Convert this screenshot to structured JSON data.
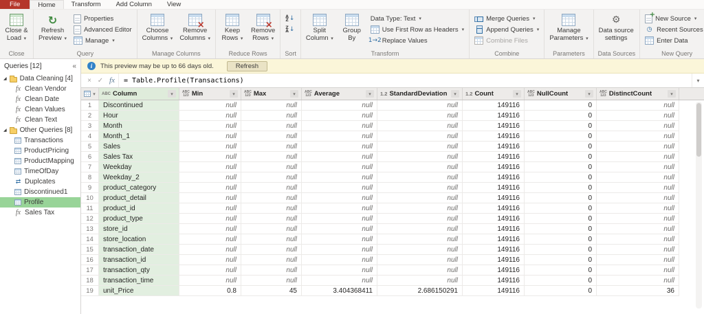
{
  "tabbar": {
    "file_label": "File",
    "tabs": [
      {
        "label": "Home",
        "active": true
      },
      {
        "label": "Transform",
        "active": false
      },
      {
        "label": "Add Column",
        "active": false
      },
      {
        "label": "View",
        "active": false
      }
    ]
  },
  "ribbon": {
    "groups": [
      {
        "label": "Close",
        "big": [
          {
            "line1": "Close &",
            "line2": "Load",
            "dropdown": true,
            "icon": "close-load"
          }
        ]
      },
      {
        "label": "Query",
        "big": [
          {
            "line1": "Refresh",
            "line2": "Preview",
            "dropdown": true,
            "icon": "refresh"
          }
        ],
        "small": [
          {
            "label": "Properties",
            "icon": "properties"
          },
          {
            "label": "Advanced Editor",
            "icon": "advanced-editor"
          },
          {
            "label": "Manage",
            "dropdown": true,
            "icon": "manage"
          }
        ]
      },
      {
        "label": "Manage Columns",
        "big": [
          {
            "line1": "Choose",
            "line2": "Columns",
            "dropdown": true,
            "icon": "choose-columns"
          },
          {
            "line1": "Remove",
            "line2": "Columns",
            "dropdown": true,
            "icon": "remove-columns"
          }
        ]
      },
      {
        "label": "Reduce Rows",
        "big": [
          {
            "line1": "Keep",
            "line2": "Rows",
            "dropdown": true,
            "icon": "keep-rows"
          },
          {
            "line1": "Remove",
            "line2": "Rows",
            "dropdown": true,
            "icon": "remove-rows"
          }
        ]
      },
      {
        "label": "Sort",
        "small_icons": [
          {
            "icon": "sort-az"
          },
          {
            "icon": "sort-za"
          }
        ]
      },
      {
        "label": "Transform",
        "big": [
          {
            "line1": "Split",
            "line2": "Column",
            "dropdown": true,
            "icon": "split-column"
          },
          {
            "line1": "Group",
            "line2": "By",
            "dropdown": false,
            "icon": "group-by"
          }
        ],
        "small": [
          {
            "label": "Data Type: Text",
            "dropdown": true
          },
          {
            "label": "Use First Row as Headers",
            "dropdown": true,
            "icon": "first-row-headers"
          },
          {
            "label": "Replace Values",
            "icon": "replace-values"
          }
        ]
      },
      {
        "label": "Combine",
        "small": [
          {
            "label": "Merge Queries",
            "dropdown": true,
            "icon": "merge-queries"
          },
          {
            "label": "Append Queries",
            "dropdown": true,
            "icon": "append-queries"
          },
          {
            "label": "Combine Files",
            "icon": "combine-files",
            "disabled": true
          }
        ]
      },
      {
        "label": "Parameters",
        "big": [
          {
            "line1": "Manage",
            "line2": "Parameters",
            "dropdown": true,
            "icon": "manage-parameters"
          }
        ]
      },
      {
        "label": "Data Sources",
        "big": [
          {
            "line1": "Data source",
            "line2": "settings",
            "dropdown": false,
            "icon": "data-source-settings"
          }
        ]
      },
      {
        "label": "New Query",
        "small": [
          {
            "label": "New Source",
            "dropdown": true,
            "icon": "new-source"
          },
          {
            "label": "Recent Sources",
            "dropdown": true,
            "icon": "recent-sources"
          },
          {
            "label": "Enter Data",
            "icon": "enter-data"
          }
        ]
      }
    ]
  },
  "notification": {
    "text": "This preview may be up to 66 days old.",
    "button_label": "Refresh"
  },
  "formula_bar": {
    "formula": "= Table.Profile(Transactions)"
  },
  "sidebar": {
    "header": "Queries [12]",
    "collapse_icon": "«",
    "tree": [
      {
        "label": "Data Cleaning [4]",
        "type": "folder",
        "expanded": true,
        "children": [
          {
            "label": "Clean Vendor",
            "type": "fx"
          },
          {
            "label": "Clean Date",
            "type": "fx"
          },
          {
            "label": "Clean Values",
            "type": "fx"
          },
          {
            "label": "Clean Text",
            "type": "fx"
          }
        ]
      },
      {
        "label": "Other Queries [8]",
        "type": "folder",
        "expanded": true,
        "children": [
          {
            "label": "Transactions",
            "type": "table"
          },
          {
            "label": "ProductPricing",
            "type": "table"
          },
          {
            "label": "ProductMapping",
            "type": "table"
          },
          {
            "label": "TimeOfDay",
            "type": "table"
          },
          {
            "label": "Duplcates",
            "type": "merge"
          },
          {
            "label": "Discontinued1",
            "type": "table"
          },
          {
            "label": "Profile",
            "type": "table",
            "selected": true
          },
          {
            "label": "Sales Tax",
            "type": "fx"
          }
        ]
      }
    ]
  },
  "grid": {
    "columns": [
      {
        "name": "Column",
        "type_icon": "ABC"
      },
      {
        "name": "Min",
        "type_icon": "ABC123"
      },
      {
        "name": "Max",
        "type_icon": "ABC123"
      },
      {
        "name": "Average",
        "type_icon": "ABC123"
      },
      {
        "name": "StandardDeviation",
        "type_icon": "1.2"
      },
      {
        "name": "Count",
        "type_icon": "1.2"
      },
      {
        "name": "NullCount",
        "type_icon": "ABC123"
      },
      {
        "name": "DistinctCount",
        "type_icon": "ABC123"
      }
    ],
    "rows": [
      {
        "n": 1,
        "cells": [
          "Discontinued",
          "null",
          "null",
          "null",
          "null",
          "149116",
          "0",
          "null"
        ]
      },
      {
        "n": 2,
        "cells": [
          "Hour",
          "null",
          "null",
          "null",
          "null",
          "149116",
          "0",
          "null"
        ]
      },
      {
        "n": 3,
        "cells": [
          "Month",
          "null",
          "null",
          "null",
          "null",
          "149116",
          "0",
          "null"
        ]
      },
      {
        "n": 4,
        "cells": [
          "Month_1",
          "null",
          "null",
          "null",
          "null",
          "149116",
          "0",
          "null"
        ]
      },
      {
        "n": 5,
        "cells": [
          "Sales",
          "null",
          "null",
          "null",
          "null",
          "149116",
          "0",
          "null"
        ]
      },
      {
        "n": 6,
        "cells": [
          "Sales Tax",
          "null",
          "null",
          "null",
          "null",
          "149116",
          "0",
          "null"
        ]
      },
      {
        "n": 7,
        "cells": [
          "Weekday",
          "null",
          "null",
          "null",
          "null",
          "149116",
          "0",
          "null"
        ]
      },
      {
        "n": 8,
        "cells": [
          "Weekday_2",
          "null",
          "null",
          "null",
          "null",
          "149116",
          "0",
          "null"
        ]
      },
      {
        "n": 9,
        "cells": [
          "product_category",
          "null",
          "null",
          "null",
          "null",
          "149116",
          "0",
          "null"
        ]
      },
      {
        "n": 10,
        "cells": [
          "product_detail",
          "null",
          "null",
          "null",
          "null",
          "149116",
          "0",
          "null"
        ]
      },
      {
        "n": 11,
        "cells": [
          "product_id",
          "null",
          "null",
          "null",
          "null",
          "149116",
          "0",
          "null"
        ]
      },
      {
        "n": 12,
        "cells": [
          "product_type",
          "null",
          "null",
          "null",
          "null",
          "149116",
          "0",
          "null"
        ]
      },
      {
        "n": 13,
        "cells": [
          "store_id",
          "null",
          "null",
          "null",
          "null",
          "149116",
          "0",
          "null"
        ]
      },
      {
        "n": 14,
        "cells": [
          "store_location",
          "null",
          "null",
          "null",
          "null",
          "149116",
          "0",
          "null"
        ]
      },
      {
        "n": 15,
        "cells": [
          "transaction_date",
          "null",
          "null",
          "null",
          "null",
          "149116",
          "0",
          "null"
        ]
      },
      {
        "n": 16,
        "cells": [
          "transaction_id",
          "null",
          "null",
          "null",
          "null",
          "149116",
          "0",
          "null"
        ]
      },
      {
        "n": 17,
        "cells": [
          "transaction_qty",
          "null",
          "null",
          "null",
          "null",
          "149116",
          "0",
          "null"
        ]
      },
      {
        "n": 18,
        "cells": [
          "transaction_time",
          "null",
          "null",
          "null",
          "null",
          "149116",
          "0",
          "null"
        ]
      },
      {
        "n": 19,
        "cells": [
          "unit_Price",
          "0.8",
          "45",
          "3.404368411",
          "2.686150291",
          "149116",
          "0",
          "36"
        ]
      }
    ]
  },
  "colors": {
    "file_tab": "#b5362a",
    "selection_green": "#98d498",
    "banner_bg": "#fbf6d9",
    "name_column_bg": "#e2efe0"
  }
}
